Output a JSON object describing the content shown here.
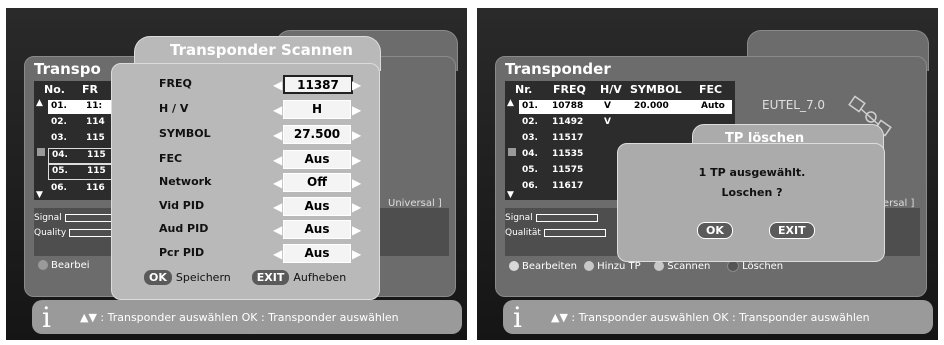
{
  "left": {
    "panel_title": "Transpo",
    "header": {
      "col1": "No.",
      "col2": "FR"
    },
    "rows": [
      {
        "no": "01.",
        "freq": "11:"
      },
      {
        "no": "02.",
        "freq": "114"
      },
      {
        "no": "03.",
        "freq": "115"
      },
      {
        "no": "04.",
        "freq": "115"
      },
      {
        "no": "05.",
        "freq": "115"
      },
      {
        "no": "06.",
        "freq": "116"
      }
    ],
    "signal_label": "Signal",
    "quality_label": "Quality",
    "bottom_button": "Bearbei",
    "universal_text": "Universal ]",
    "dialog": {
      "title": "Transponder Scannen",
      "fields": [
        {
          "label": "FREQ",
          "value": "11387"
        },
        {
          "label": "H / V",
          "value": "H"
        },
        {
          "label": "SYMBOL",
          "value": "27.500"
        },
        {
          "label": "FEC",
          "value": "Aus"
        },
        {
          "label": "Network",
          "value": "Off"
        },
        {
          "label": "Vid  PID",
          "value": "Aus"
        },
        {
          "label": "Aud  PID",
          "value": "Aus"
        },
        {
          "label": "Pcr  PID",
          "value": "Aus"
        }
      ],
      "ok_key": "OK",
      "ok_label": "Speichern",
      "exit_key": "EXIT",
      "exit_label": "Aufheben"
    },
    "info_icon": "i",
    "info_text": "▲▼ : Transponder auswählen  OK : Transponder auswählen"
  },
  "right": {
    "panel_title": "Transponder",
    "header": {
      "nr": "Nr.",
      "freq": "FREQ",
      "hv": "H/V",
      "symbol": "SYMBOL",
      "fec": "FEC"
    },
    "rows": [
      {
        "nr": "01.",
        "freq": "10788",
        "hv": "V",
        "symbol": "20.000",
        "fec": "Auto"
      },
      {
        "nr": "02.",
        "freq": "11492",
        "hv": "V",
        "symbol": "",
        "fec": ""
      },
      {
        "nr": "03.",
        "freq": "11517",
        "hv": "",
        "symbol": "",
        "fec": ""
      },
      {
        "nr": "04.",
        "freq": "11535",
        "hv": "",
        "symbol": "",
        "fec": ""
      },
      {
        "nr": "05.",
        "freq": "11575",
        "hv": "",
        "symbol": "",
        "fec": ""
      },
      {
        "nr": "06.",
        "freq": "11617",
        "hv": "",
        "symbol": "",
        "fec": ""
      }
    ],
    "satellite": "EUTEL_7.0",
    "signal_label": "Signal",
    "quality_label": "Qualität",
    "universal_text": "versal ]",
    "buttons": [
      "Bearbeiten",
      "Hinzu TP",
      "Scannen",
      "Löschen"
    ],
    "button_colors": [
      "#d9d9d9",
      "#c8c8c8",
      "#c8c8c8",
      "#555555"
    ],
    "dialog": {
      "title": "TP löschen",
      "line1": "1 TP ausgewählt.",
      "line2": "Loschen ?",
      "ok": "OK",
      "exit": "EXIT"
    },
    "info_icon": "i",
    "info_text": "▲▼ : Transponder auswählen  OK : Transponder auswählen"
  }
}
